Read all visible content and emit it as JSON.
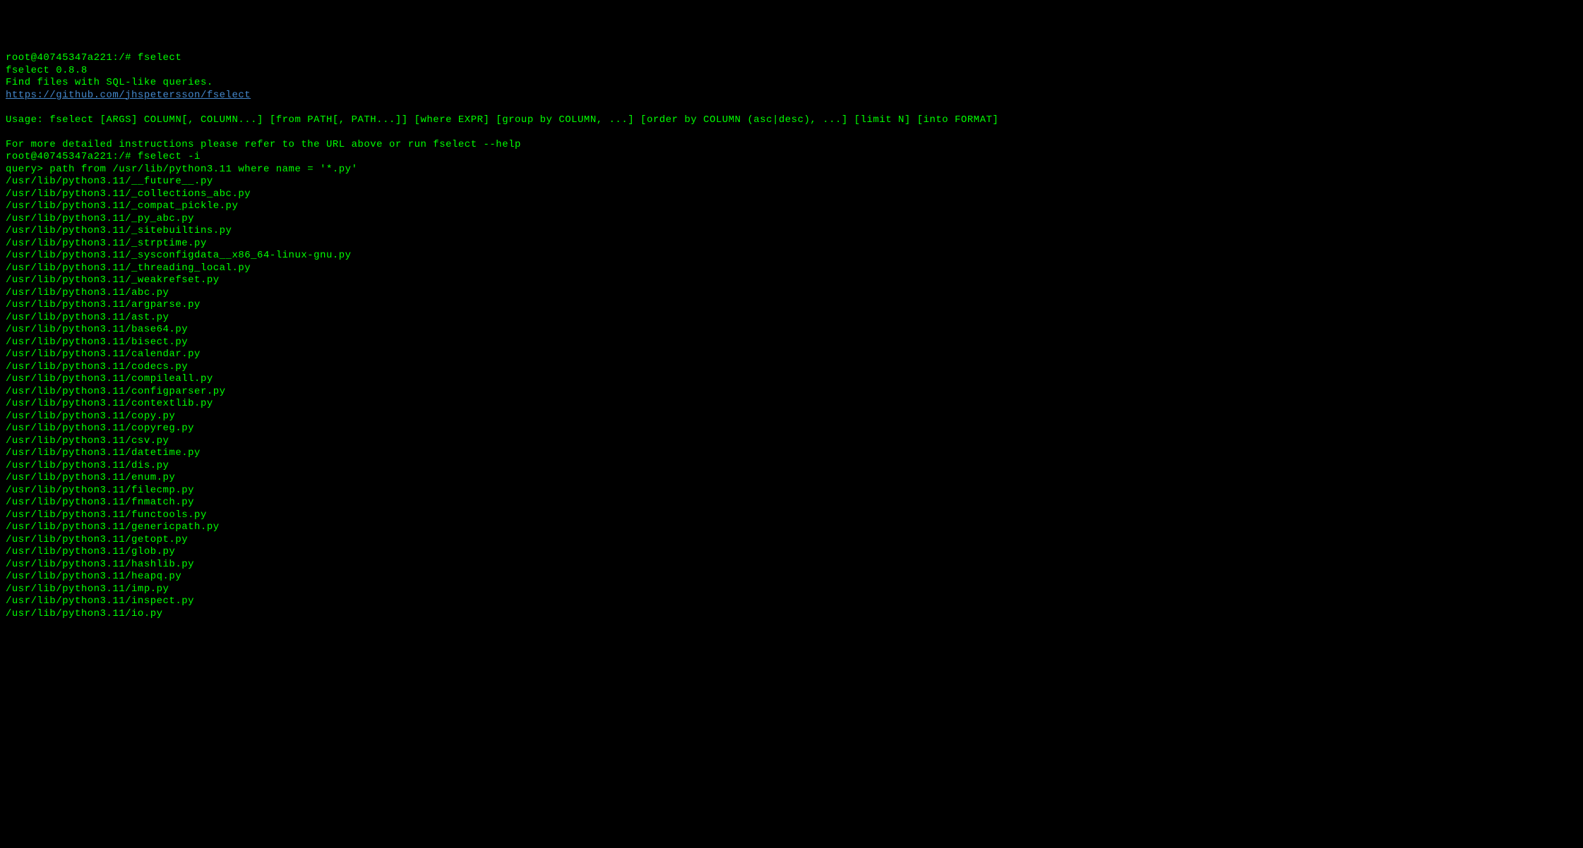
{
  "lines": [
    {
      "type": "text",
      "content": "root@40745347a221:/# fselect"
    },
    {
      "type": "text",
      "content": "fselect 0.8.8"
    },
    {
      "type": "text",
      "content": "Find files with SQL-like queries."
    },
    {
      "type": "link",
      "content": "https://github.com/jhspetersson/fselect"
    },
    {
      "type": "empty"
    },
    {
      "type": "text",
      "content": "Usage: fselect [ARGS] COLUMN[, COLUMN...] [from PATH[, PATH...]] [where EXPR] [group by COLUMN, ...] [order by COLUMN (asc|desc), ...] [limit N] [into FORMAT]"
    },
    {
      "type": "empty"
    },
    {
      "type": "text",
      "content": "For more detailed instructions please refer to the URL above or run fselect --help"
    },
    {
      "type": "text",
      "content": "root@40745347a221:/# fselect -i"
    },
    {
      "type": "text",
      "content": "query> path from /usr/lib/python3.11 where name = '*.py'"
    },
    {
      "type": "text",
      "content": "/usr/lib/python3.11/__future__.py"
    },
    {
      "type": "text",
      "content": "/usr/lib/python3.11/_collections_abc.py"
    },
    {
      "type": "text",
      "content": "/usr/lib/python3.11/_compat_pickle.py"
    },
    {
      "type": "text",
      "content": "/usr/lib/python3.11/_py_abc.py"
    },
    {
      "type": "text",
      "content": "/usr/lib/python3.11/_sitebuiltins.py"
    },
    {
      "type": "text",
      "content": "/usr/lib/python3.11/_strptime.py"
    },
    {
      "type": "text",
      "content": "/usr/lib/python3.11/_sysconfigdata__x86_64-linux-gnu.py"
    },
    {
      "type": "text",
      "content": "/usr/lib/python3.11/_threading_local.py"
    },
    {
      "type": "text",
      "content": "/usr/lib/python3.11/_weakrefset.py"
    },
    {
      "type": "text",
      "content": "/usr/lib/python3.11/abc.py"
    },
    {
      "type": "text",
      "content": "/usr/lib/python3.11/argparse.py"
    },
    {
      "type": "text",
      "content": "/usr/lib/python3.11/ast.py"
    },
    {
      "type": "text",
      "content": "/usr/lib/python3.11/base64.py"
    },
    {
      "type": "text",
      "content": "/usr/lib/python3.11/bisect.py"
    },
    {
      "type": "text",
      "content": "/usr/lib/python3.11/calendar.py"
    },
    {
      "type": "text",
      "content": "/usr/lib/python3.11/codecs.py"
    },
    {
      "type": "text",
      "content": "/usr/lib/python3.11/compileall.py"
    },
    {
      "type": "text",
      "content": "/usr/lib/python3.11/configparser.py"
    },
    {
      "type": "text",
      "content": "/usr/lib/python3.11/contextlib.py"
    },
    {
      "type": "text",
      "content": "/usr/lib/python3.11/copy.py"
    },
    {
      "type": "text",
      "content": "/usr/lib/python3.11/copyreg.py"
    },
    {
      "type": "text",
      "content": "/usr/lib/python3.11/csv.py"
    },
    {
      "type": "text",
      "content": "/usr/lib/python3.11/datetime.py"
    },
    {
      "type": "text",
      "content": "/usr/lib/python3.11/dis.py"
    },
    {
      "type": "text",
      "content": "/usr/lib/python3.11/enum.py"
    },
    {
      "type": "text",
      "content": "/usr/lib/python3.11/filecmp.py"
    },
    {
      "type": "text",
      "content": "/usr/lib/python3.11/fnmatch.py"
    },
    {
      "type": "text",
      "content": "/usr/lib/python3.11/functools.py"
    },
    {
      "type": "text",
      "content": "/usr/lib/python3.11/genericpath.py"
    },
    {
      "type": "text",
      "content": "/usr/lib/python3.11/getopt.py"
    },
    {
      "type": "text",
      "content": "/usr/lib/python3.11/glob.py"
    },
    {
      "type": "text",
      "content": "/usr/lib/python3.11/hashlib.py"
    },
    {
      "type": "text",
      "content": "/usr/lib/python3.11/heapq.py"
    },
    {
      "type": "text",
      "content": "/usr/lib/python3.11/imp.py"
    },
    {
      "type": "text",
      "content": "/usr/lib/python3.11/inspect.py"
    },
    {
      "type": "text",
      "content": "/usr/lib/python3.11/io.py"
    }
  ]
}
